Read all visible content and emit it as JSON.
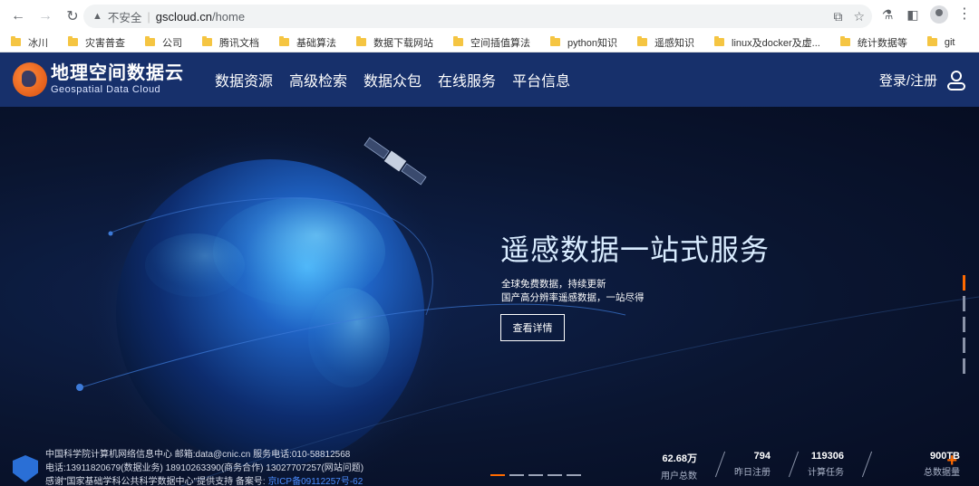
{
  "browser": {
    "security_label": "不安全",
    "url_domain": "gscloud.cn",
    "url_path": "/home"
  },
  "bookmarks": [
    "冰川",
    "灾害普查",
    "公司",
    "腾讯文档",
    "基础算法",
    "数据下载网站",
    "空间插值算法",
    "python知识",
    "遥感知识",
    "linux及docker及虚...",
    "统计数据等",
    "git"
  ],
  "site": {
    "logo_cn": "地理空间数据云",
    "logo_en": "Geospatial Data Cloud",
    "nav": [
      "数据资源",
      "高级检索",
      "数据众包",
      "在线服务",
      "平台信息"
    ],
    "login": "登录/注册"
  },
  "hero": {
    "title": "遥感数据一站式服务",
    "sub1": "全球免费数据，持续更新",
    "sub2": "国产高分辨率遥感数据，一站尽得",
    "button": "查看详情",
    "side_dots_active": 0,
    "slide_dots_active": 0
  },
  "footer": {
    "line1": "中国科学院计算机网络信息中心 邮箱:data@cnic.cn 服务电话:010-58812568",
    "line2": "电话:13911820679(数据业务) 18910263390(商务合作) 13027707257(网站问题)",
    "line3_prefix": "感谢\"国家基础学科公共科学数据中心\"提供支持 备案号: ",
    "icp": "京ICP备09112257号-62"
  },
  "stats": [
    {
      "value": "62.68万",
      "label": "用户总数"
    },
    {
      "value": "794",
      "label": "昨日注册"
    },
    {
      "value": "119306",
      "label": "计算任务"
    },
    {
      "value": "900TB",
      "label": "总数据量"
    }
  ],
  "icons": {
    "back": "arrow-left-icon",
    "forward": "arrow-right-icon",
    "reload": "reload-icon",
    "warning": "warning-icon",
    "share": "share-icon",
    "star": "star-icon",
    "extension": "flask-icon",
    "sidepanel": "side-panel-icon",
    "profile": "profile-icon",
    "menu": "menu-dots-icon",
    "user": "user-icon",
    "plus": "plus-icon"
  },
  "colors": {
    "header_bg": "#17306b",
    "accent": "#ff6a00",
    "hero_title": "#d9ecff",
    "link": "#4a8cff"
  }
}
